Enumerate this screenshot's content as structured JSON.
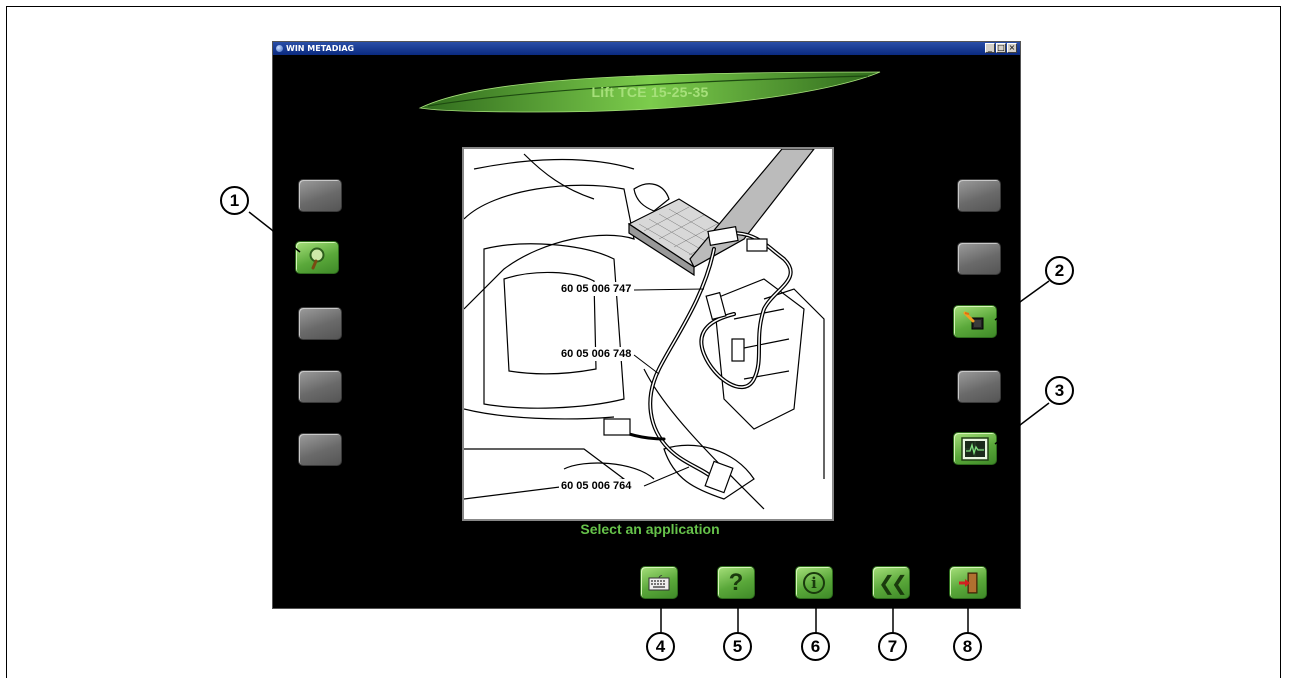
{
  "window": {
    "title": "WIN METADIAG",
    "buttons": {
      "minimize": "_",
      "maximize": "□",
      "close": "×"
    }
  },
  "app_title": "Lift TCE 15-25-35",
  "status_text": "Select an application",
  "photo": {
    "part_labels": [
      "60 05 006 747",
      "60 05 006 748",
      "60 05 006 764"
    ]
  },
  "left_buttons": [
    {
      "icon": ""
    },
    {
      "icon": "magnifier-icon"
    },
    {
      "icon": ""
    },
    {
      "icon": ""
    },
    {
      "icon": ""
    }
  ],
  "right_buttons": [
    {
      "icon": ""
    },
    {
      "icon": ""
    },
    {
      "icon": "connector-icon"
    },
    {
      "icon": ""
    },
    {
      "icon": "oscilloscope-icon"
    }
  ],
  "bottom_buttons": [
    {
      "icon": "keyboard-icon"
    },
    {
      "icon": "help-icon",
      "glyph": "?"
    },
    {
      "icon": "info-icon",
      "glyph": "i"
    },
    {
      "icon": "back-icon",
      "glyph": "❮❮"
    },
    {
      "icon": "exit-icon"
    }
  ],
  "callouts": [
    "1",
    "2",
    "3",
    "4",
    "5",
    "6",
    "7",
    "8"
  ],
  "colors": {
    "accent_green": "#66c24a",
    "title_green": "#a6e07a",
    "background": "#000000",
    "button_grey": "#7a7a7a"
  }
}
